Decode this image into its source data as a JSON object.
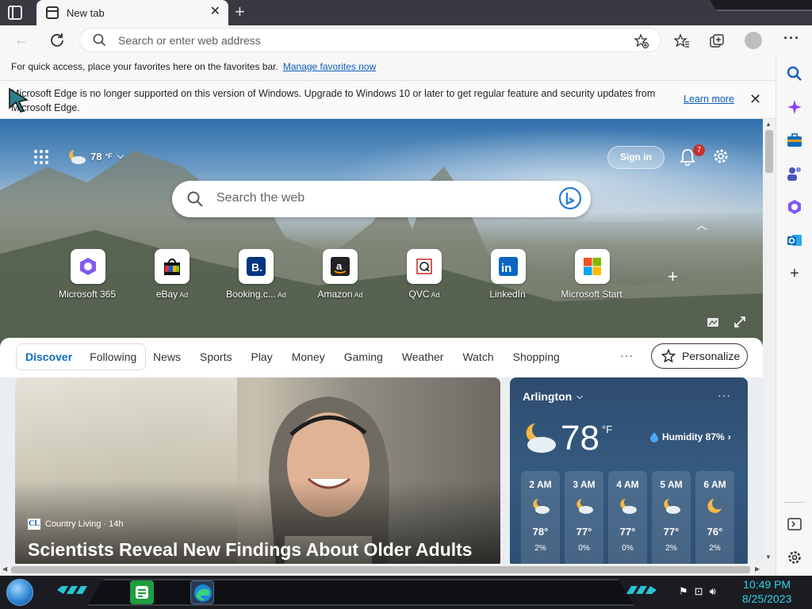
{
  "browser": {
    "tab": {
      "title": "New tab"
    },
    "address_bar": {
      "placeholder": "Search or enter web address"
    },
    "favorites_bar": {
      "text": "For quick access, place your favorites here on the favorites bar.",
      "link": "Manage favorites now"
    },
    "info_bar": {
      "text": "Microsoft Edge is no longer supported on this version of Windows. Upgrade to Windows 10 or later to get regular feature and security updates from Microsoft Edge.",
      "link": "Learn more"
    }
  },
  "new_tab_page": {
    "weather_chip": {
      "temp": "78",
      "unit": "°F"
    },
    "sign_in_label": "Sign in",
    "notification_count": "7",
    "search": {
      "placeholder": "Search the web"
    },
    "quick_links": [
      {
        "label": "Microsoft 365",
        "ad": ""
      },
      {
        "label": "eBay",
        "ad": "Ad"
      },
      {
        "label": "Booking.c...",
        "ad": "Ad"
      },
      {
        "label": "Amazon",
        "ad": "Ad"
      },
      {
        "label": "QVC",
        "ad": "Ad"
      },
      {
        "label": "LinkedIn",
        "ad": ""
      },
      {
        "label": "Microsoft Start",
        "ad": ""
      }
    ],
    "feed_tabs": [
      "Discover",
      "Following"
    ],
    "feed_links": [
      "News",
      "Sports",
      "Play",
      "Money",
      "Gaming",
      "Weather",
      "Watch",
      "Shopping"
    ],
    "more_label": "···",
    "personalize_label": "Personalize",
    "hero_card": {
      "source_logo": "CL",
      "source": "Country Living · 14h",
      "headline": "Scientists Reveal New Findings About Older Adults"
    },
    "weather_card": {
      "location": "Arlington",
      "temp": "78",
      "unit": "°F",
      "humidity": "Humidity 87%",
      "hourly": [
        {
          "time": "2 AM",
          "temp": "78°",
          "precip": "2%"
        },
        {
          "time": "3 AM",
          "temp": "77°",
          "precip": "0%"
        },
        {
          "time": "4 AM",
          "temp": "77°",
          "precip": "0%"
        },
        {
          "time": "5 AM",
          "temp": "77°",
          "precip": "2%"
        },
        {
          "time": "6 AM",
          "temp": "76°",
          "precip": "2%"
        }
      ]
    }
  },
  "taskbar": {
    "time": "10:49 PM",
    "date": "8/25/2023"
  },
  "colors": {
    "accent": "#0f6cbd",
    "link": "#0f5bb5",
    "clock": "#2fd3e6",
    "badge": "#c4302b"
  }
}
